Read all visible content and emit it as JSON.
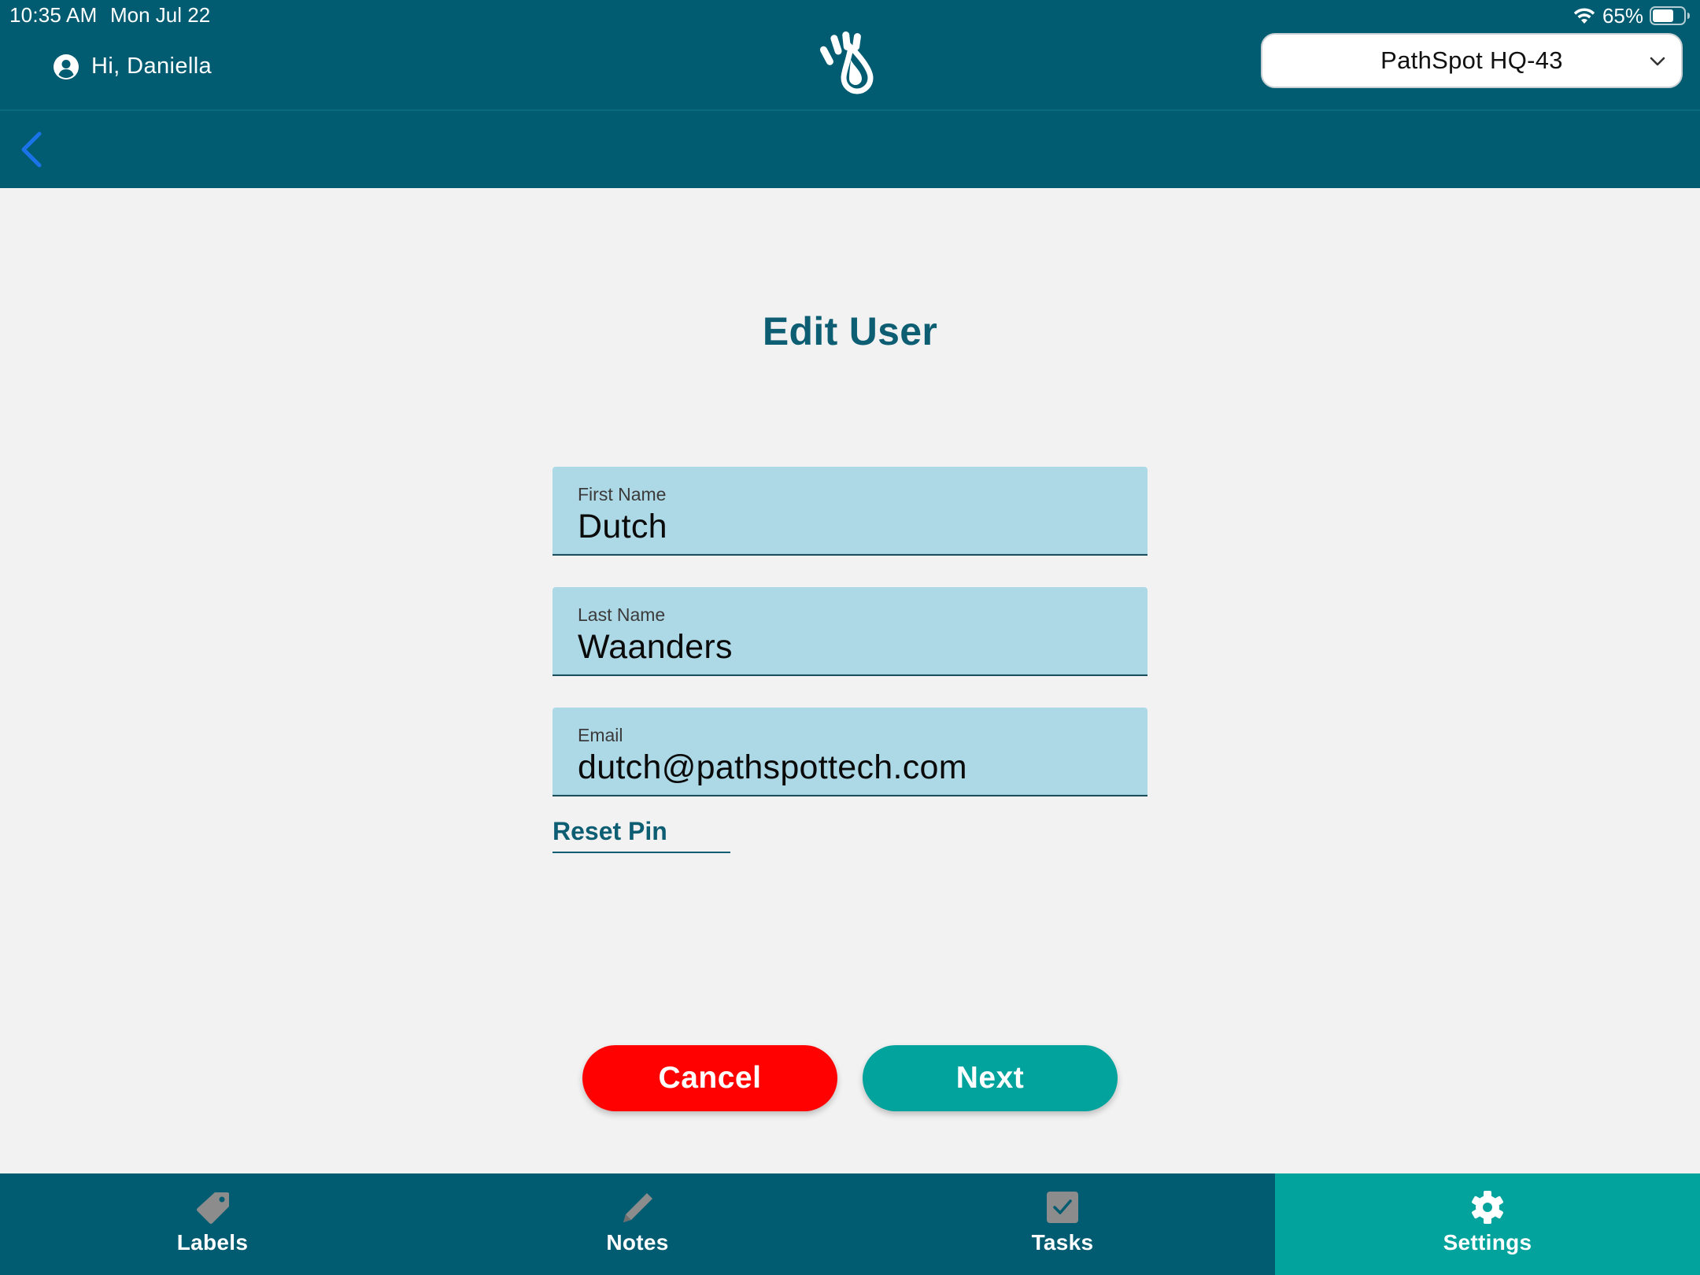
{
  "status_bar": {
    "time": "10:35 AM",
    "date": "Mon Jul 22",
    "battery": "65%"
  },
  "header": {
    "greeting": "Hi, Daniella",
    "location": "PathSpot HQ-43"
  },
  "page": {
    "title": "Edit User"
  },
  "form": {
    "first_name": {
      "label": "First Name",
      "value": "Dutch"
    },
    "last_name": {
      "label": "Last Name",
      "value": "Waanders"
    },
    "email": {
      "label": "Email",
      "value": "dutch@pathspottech.com"
    },
    "reset_pin": "Reset Pin"
  },
  "actions": {
    "cancel": "Cancel",
    "next": "Next"
  },
  "tabs": [
    {
      "label": "Labels",
      "icon": "tag-icon"
    },
    {
      "label": "Notes",
      "icon": "pencil-icon"
    },
    {
      "label": "Tasks",
      "icon": "checkbox-icon"
    },
    {
      "label": "Settings",
      "icon": "gear-icon",
      "active": true
    }
  ],
  "colors": {
    "header": "#015c72",
    "accent": "#01a39c",
    "cancel": "#ff0101",
    "field_bg": "#add8e6",
    "title": "#0d5e72",
    "back_arrow": "#1a73e8"
  }
}
